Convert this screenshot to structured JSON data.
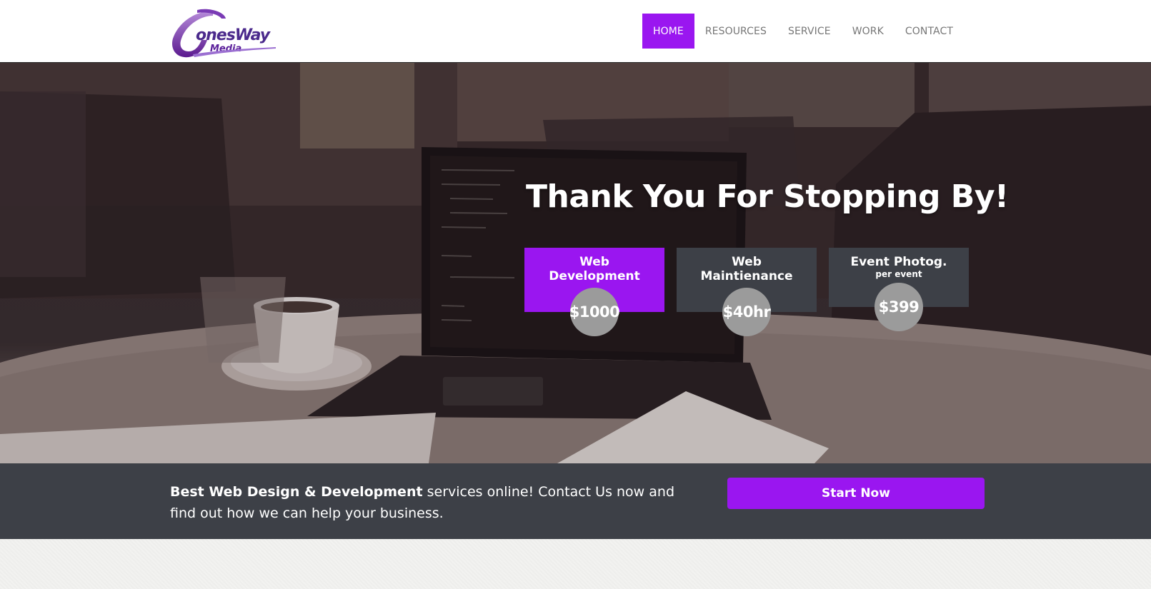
{
  "header": {
    "logo": {
      "name": "JonesWay Media",
      "primary": "JonesWay",
      "secondary": "Media"
    },
    "nav": [
      {
        "label": "HOME",
        "active": true
      },
      {
        "label": "RESOURCES",
        "active": false
      },
      {
        "label": "SERVICE",
        "active": false
      },
      {
        "label": "WORK",
        "active": false
      },
      {
        "label": "CONTACT",
        "active": false
      }
    ]
  },
  "hero": {
    "title": "Thank You For Stopping By!",
    "cards": [
      {
        "line1": "Web",
        "line2": "Development",
        "sub": "",
        "price": "$1000"
      },
      {
        "line1": "Web",
        "line2": "Maintienance",
        "sub": "",
        "price": "$40hr"
      },
      {
        "line1": "Event Photog.",
        "line2": "",
        "sub": "per event",
        "price": "$399"
      }
    ]
  },
  "cta": {
    "bold_text": "Best Web Design & Development",
    "text": " services online! Contact Us now and find out how we can help your business.",
    "button": "Start Now"
  },
  "colors": {
    "accent": "#9a16f0",
    "dark": "#3d4047",
    "price_circle": "#9b9b9b"
  }
}
